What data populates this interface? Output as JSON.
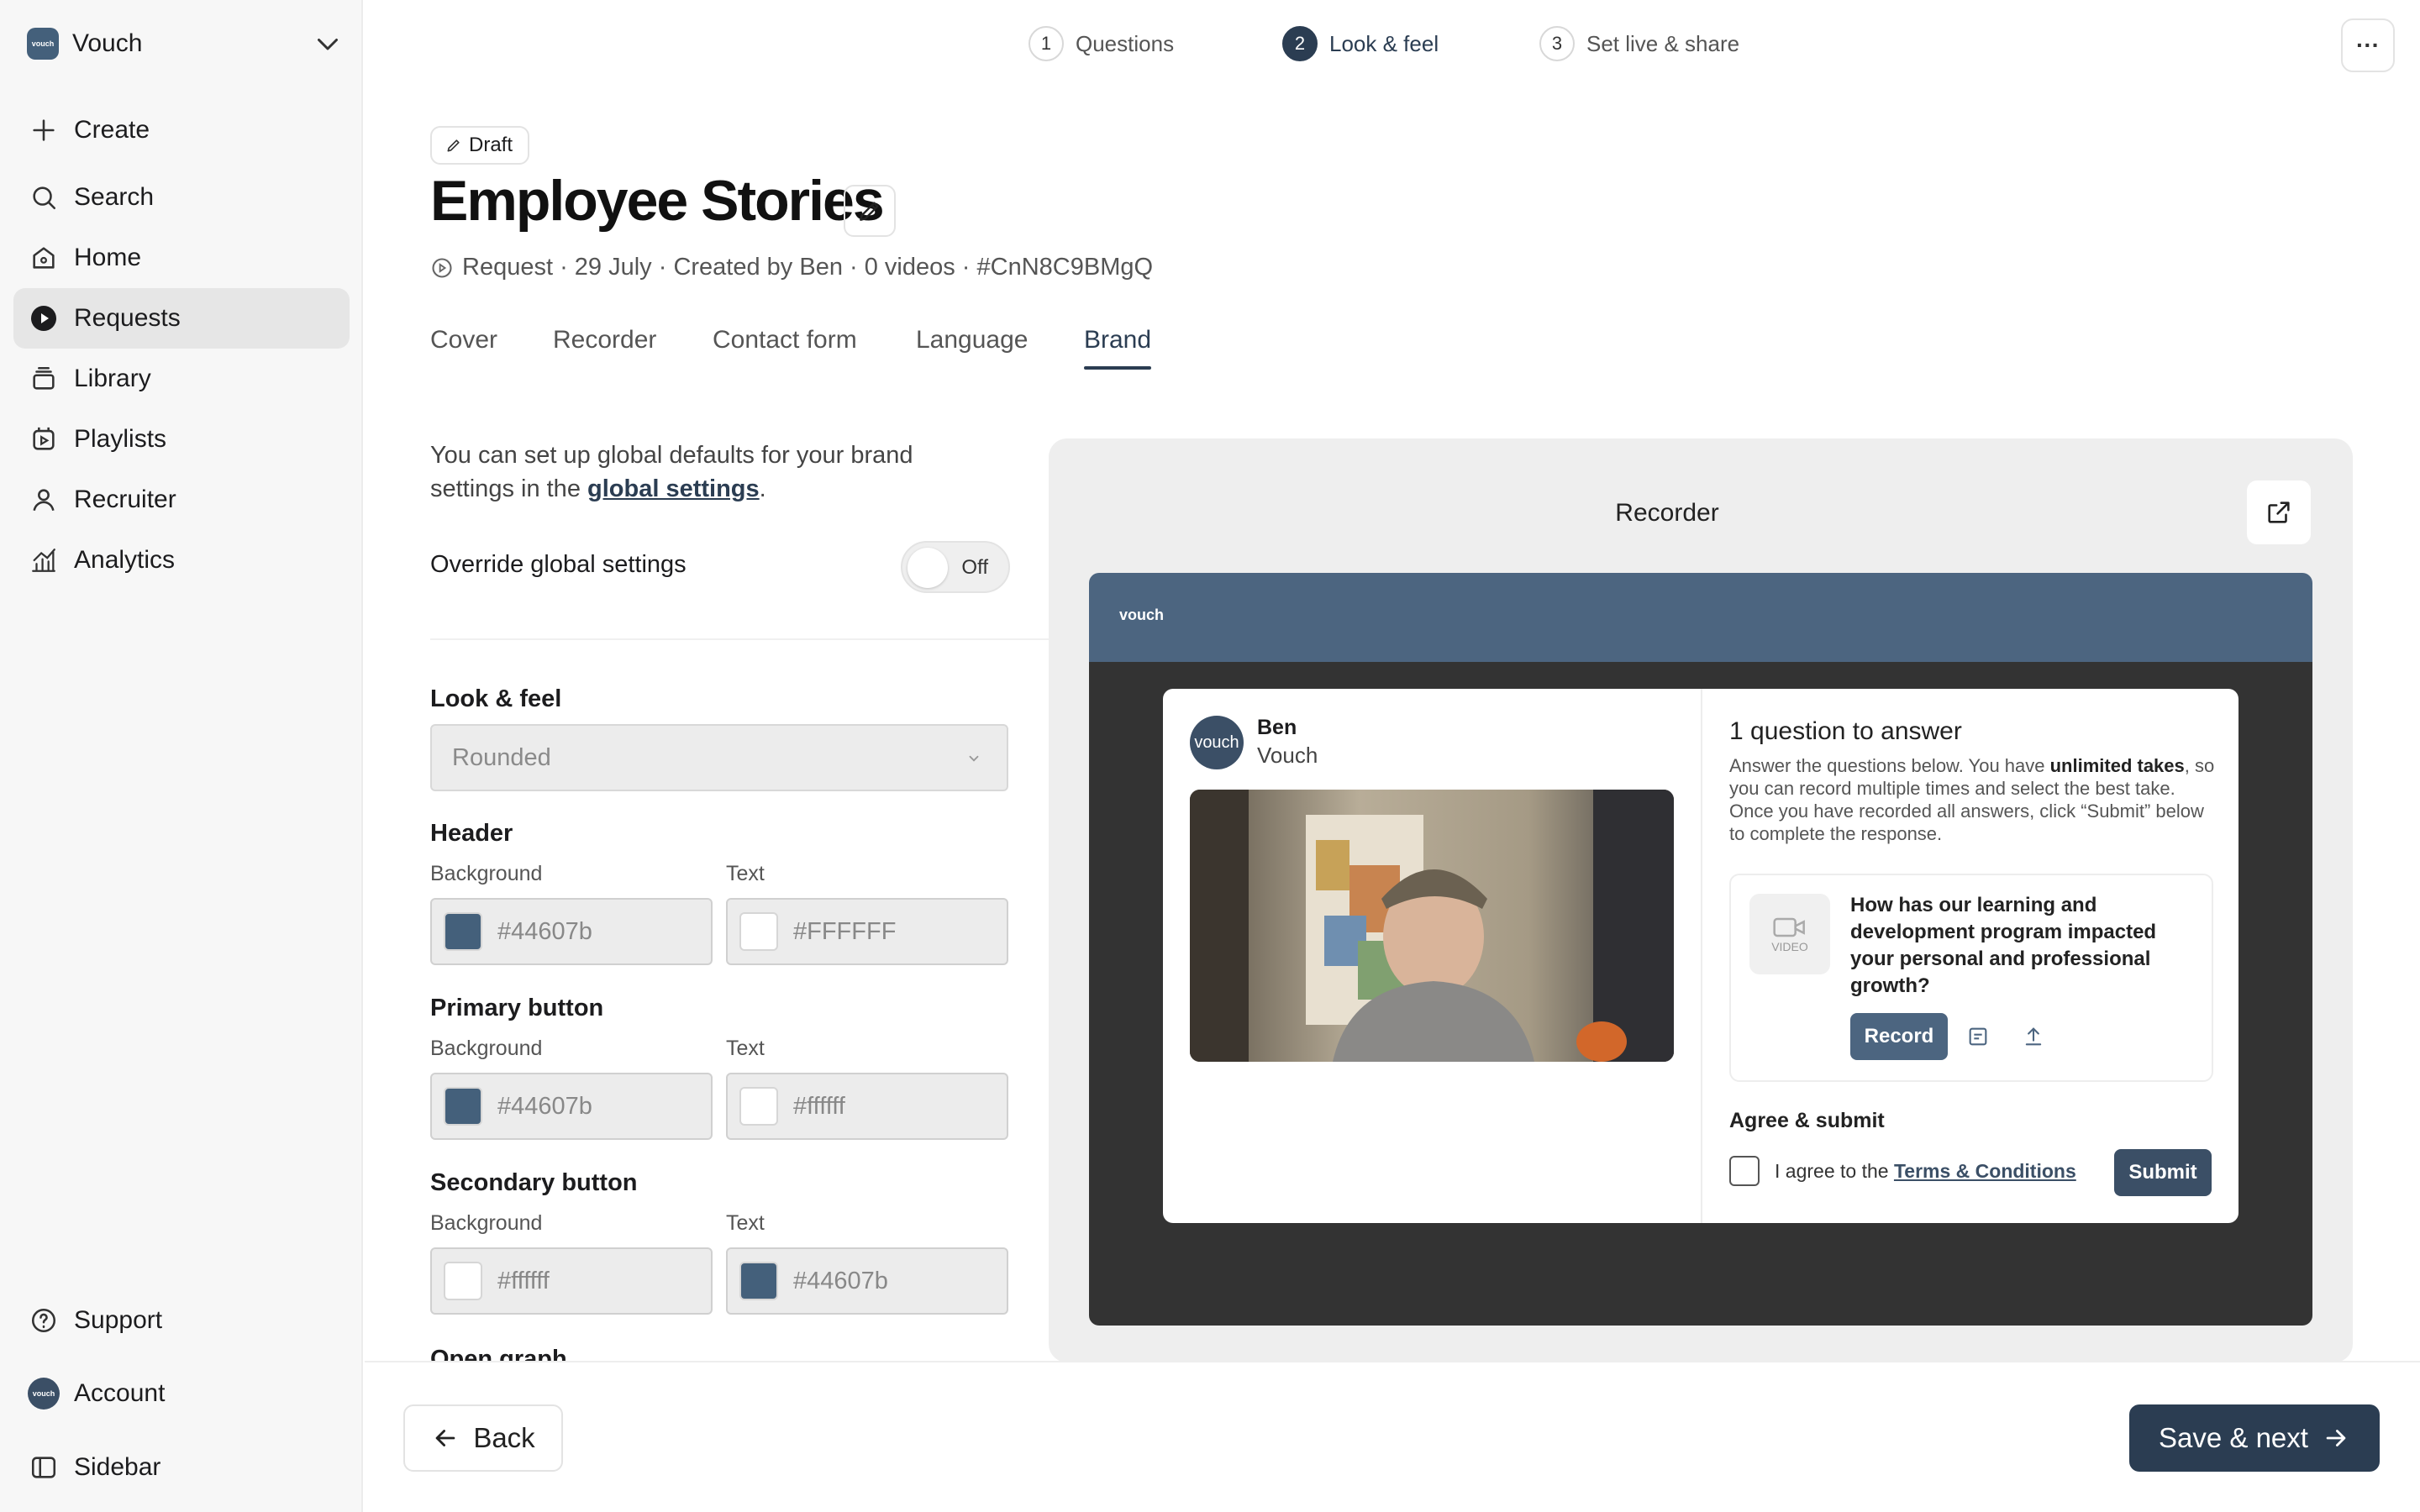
{
  "workspace": {
    "name": "Vouch",
    "logo_text": "vouch"
  },
  "sidebar": {
    "items": [
      {
        "label": "Create",
        "icon": "plus-icon"
      },
      {
        "label": "Search",
        "icon": "search-icon"
      },
      {
        "label": "Home",
        "icon": "home-icon"
      },
      {
        "label": "Requests",
        "icon": "requests-icon",
        "active": true
      },
      {
        "label": "Library",
        "icon": "library-icon"
      },
      {
        "label": "Playlists",
        "icon": "playlists-icon"
      },
      {
        "label": "Recruiter",
        "icon": "recruiter-icon"
      },
      {
        "label": "Analytics",
        "icon": "analytics-icon"
      }
    ],
    "bottom": [
      {
        "label": "Support",
        "icon": "help-icon"
      },
      {
        "label": "Account",
        "icon": "avatar-icon"
      },
      {
        "label": "Sidebar",
        "icon": "sidebar-icon"
      }
    ]
  },
  "stepper": [
    {
      "num": "1",
      "label": "Questions"
    },
    {
      "num": "2",
      "label": "Look & feel",
      "active": true
    },
    {
      "num": "3",
      "label": "Set live & share"
    }
  ],
  "header": {
    "status": "Draft",
    "title": "Employee Stories",
    "meta": "Request · 29 July · Created by Ben · 0 videos · #CnN8C9BMgQ"
  },
  "tabs": [
    "Cover",
    "Recorder",
    "Contact form",
    "Language",
    "Brand"
  ],
  "active_tab": "Brand",
  "settings": {
    "intro_before": "You can set up global defaults for your brand settings in the ",
    "intro_link": "global settings",
    "intro_after": ".",
    "override_label": "Override global settings",
    "toggle_state": "Off",
    "look_feel_label": "Look & feel",
    "look_feel_value": "Rounded",
    "background_label": "Background",
    "text_label": "Text",
    "header": {
      "label": "Header",
      "bg": "#44607b",
      "text": "#FFFFFF"
    },
    "primary": {
      "label": "Primary button",
      "bg": "#44607b",
      "text": "#ffffff"
    },
    "secondary": {
      "label": "Secondary button",
      "bg": "#ffffff",
      "text": "#44607b"
    },
    "next_section": "Open graph"
  },
  "preview": {
    "title": "Recorder",
    "header_logo": "vouch",
    "sender_name": "Ben",
    "sender_org": "Vouch",
    "avatar_text": "vouch",
    "questions_heading": "1 question to answer",
    "desc_1": "Answer the questions below. You have ",
    "desc_bold": "unlimited takes",
    "desc_2": ", so you can record multiple times and select the best take. Once you have recorded all answers, click “Submit” below to complete the response.",
    "video_placeholder": "VIDEO",
    "question": "How has our learning and development program impacted your personal and professional growth?",
    "record_label": "Record",
    "agree_heading": "Agree & submit",
    "agree_text": "I agree to the ",
    "terms_link": "Terms & Conditions",
    "submit_label": "Submit"
  },
  "footer": {
    "back": "Back",
    "save": "Save & next"
  },
  "colors": {
    "brand": "#44607b",
    "dark": "#2b3d52"
  }
}
